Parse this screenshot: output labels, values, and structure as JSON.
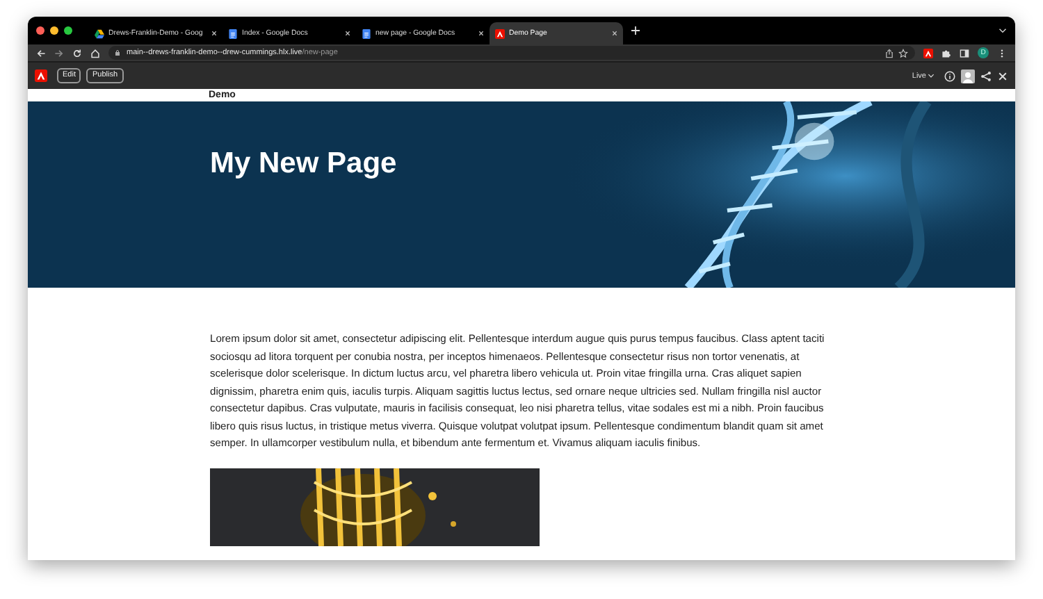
{
  "browser": {
    "tabs": [
      {
        "title": "Drews-Franklin-Demo - Goog",
        "selected": false
      },
      {
        "title": "Index - Google Docs",
        "selected": false
      },
      {
        "title": "new page - Google Docs",
        "selected": false
      },
      {
        "title": "Demo Page",
        "selected": true
      }
    ],
    "address": {
      "host": "main--drews-franklin-demo--drew-cummings.hlx.live",
      "path": "/new-page"
    },
    "profile_initial": "D"
  },
  "sidekick": {
    "buttons": [
      "Edit",
      "Publish"
    ],
    "environment": "Live"
  },
  "page": {
    "nav_text": "Demo",
    "hero_title": "My New Page",
    "paragraph": "Lorem ipsum dolor sit amet, consectetur adipiscing elit. Pellentesque interdum augue quis purus tempus faucibus. Class aptent taciti sociosqu ad litora torquent per conubia nostra, per inceptos himenaeos. Pellentesque consectetur risus non tortor venenatis, at scelerisque dolor scelerisque. In dictum luctus arcu, vel pharetra libero vehicula ut. Proin vitae fringilla urna. Cras aliquet sapien dignissim, pharetra enim quis, iaculis turpis. Aliquam sagittis luctus lectus, sed ornare neque ultricies sed. Nullam fringilla nisl auctor consectetur dapibus. Cras vulputate, mauris in facilisis consequat, leo nisi pharetra tellus, vitae sodales est mi a nibh. Proin faucibus libero quis risus luctus, in tristique metus viverra. Quisque volutpat volutpat ipsum. Pellentesque condimentum blandit quam sit amet semper. In ullamcorper vestibulum nulla, et bibendum ante fermentum et. Vivamus aliquam iaculis finibus."
  }
}
